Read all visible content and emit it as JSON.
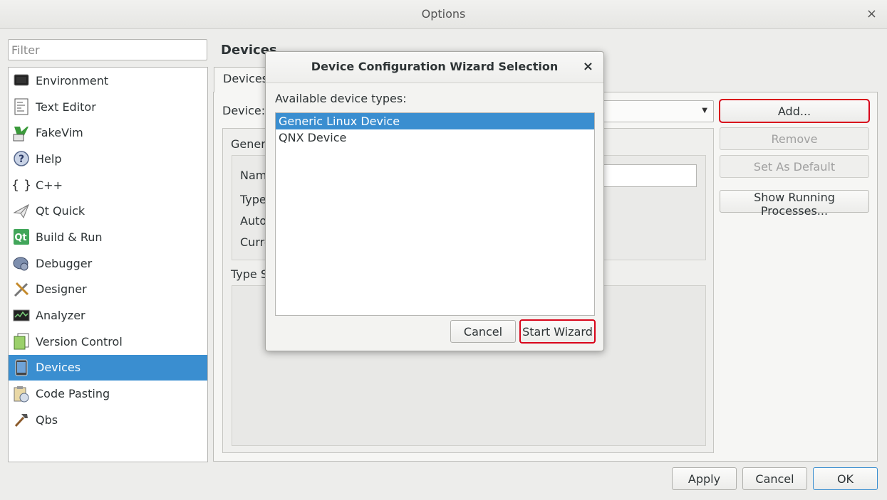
{
  "window": {
    "title": "Options",
    "close_glyph": "×"
  },
  "filter": {
    "placeholder": "Filter",
    "value": ""
  },
  "categories": [
    {
      "label": "Environment",
      "icon": "monitor-icon"
    },
    {
      "label": "Text Editor",
      "icon": "text-editor-icon"
    },
    {
      "label": "FakeVim",
      "icon": "fakevim-icon"
    },
    {
      "label": "Help",
      "icon": "help-icon"
    },
    {
      "label": "C++",
      "icon": "braces-icon"
    },
    {
      "label": "Qt Quick",
      "icon": "paper-plane-icon"
    },
    {
      "label": "Build & Run",
      "icon": "qt-build-icon"
    },
    {
      "label": "Debugger",
      "icon": "debugger-icon"
    },
    {
      "label": "Designer",
      "icon": "designer-icon"
    },
    {
      "label": "Analyzer",
      "icon": "analyzer-icon"
    },
    {
      "label": "Version Control",
      "icon": "version-control-icon"
    },
    {
      "label": "Devices",
      "icon": "device-icon",
      "selected": true
    },
    {
      "label": "Code Pasting",
      "icon": "code-pasting-icon"
    },
    {
      "label": "Qbs",
      "icon": "hammer-icon"
    }
  ],
  "page": {
    "title": "Devices",
    "tab_label": "Devices",
    "device_label": "Device:",
    "general_label": "Genera",
    "name_label": "Nam",
    "type_label": "Type",
    "auto_label": "Auto",
    "current_label": "Curre",
    "type_specific_label": "Type S"
  },
  "side_buttons": {
    "add": "Add...",
    "remove": "Remove",
    "set_default": "Set As Default",
    "show_processes": "Show Running Processes..."
  },
  "footer": {
    "apply": "Apply",
    "cancel": "Cancel",
    "ok": "OK"
  },
  "dialog": {
    "title": "Device Configuration Wizard Selection",
    "close_glyph": "×",
    "available_label": "Available device types:",
    "device_types": [
      "Generic Linux Device",
      "QNX Device"
    ],
    "selected_index": 0,
    "cancel": "Cancel",
    "start_wizard": "Start Wizard"
  },
  "colors": {
    "selection": "#3a8ed0",
    "highlight_ring": "#d9061b"
  }
}
